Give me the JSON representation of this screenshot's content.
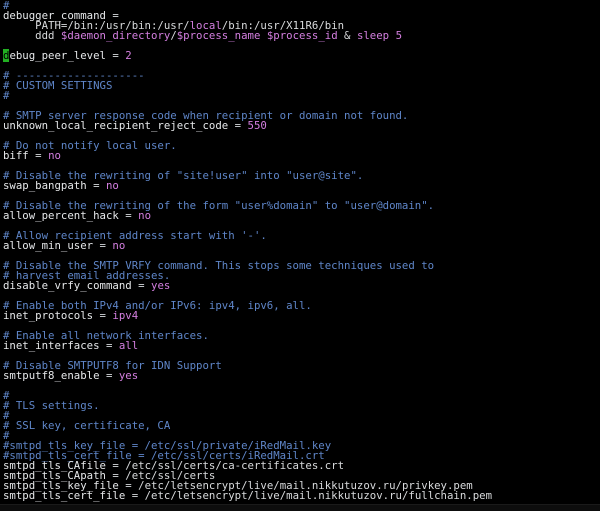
{
  "lines": [
    {
      "comment": "#"
    },
    {
      "key": "debugger_command",
      "eq": " ="
    },
    {
      "plain_a": "     PATH=/bin:/usr/bin:/usr/",
      "local": "local",
      "plain_b": "/bin:/usr/X11R6/bin"
    },
    {
      "plain_a": "     ddd ",
      "v1": "$daemon_directory",
      "plain_b": "/",
      "v2": "$process_name",
      "plain_c": " ",
      "v3": "$process_id",
      "plain_d": " & ",
      "v4": "sleep",
      "plain_e": " ",
      "v5": "5"
    },
    {
      "blank": true
    },
    {
      "cursor": "d",
      "key": "ebug_peer_level",
      "eq": " = ",
      "val": "2"
    },
    {
      "blank": true
    },
    {
      "comment": "# --------------------"
    },
    {
      "comment": "# CUSTOM SETTINGS"
    },
    {
      "comment": "#"
    },
    {
      "blank": true
    },
    {
      "comment": "# SMTP server response code when recipient or domain not found."
    },
    {
      "key": "unknown_local_recipient_reject_code",
      "eq": " = ",
      "val": "550"
    },
    {
      "blank": true
    },
    {
      "comment": "# Do not notify local user."
    },
    {
      "key": "biff",
      "eq": " = ",
      "val": "no"
    },
    {
      "blank": true
    },
    {
      "comment": "# Disable the rewriting of \"site!user\" into \"user@site\"."
    },
    {
      "key": "swap_bangpath",
      "eq": " = ",
      "val": "no"
    },
    {
      "blank": true
    },
    {
      "comment": "# Disable the rewriting of the form \"user%domain\" to \"user@domain\"."
    },
    {
      "key": "allow_percent_hack",
      "eq": " = ",
      "val": "no"
    },
    {
      "blank": true
    },
    {
      "comment": "# Allow recipient address start with '-'."
    },
    {
      "key": "allow_min_user",
      "eq": " = ",
      "val": "no"
    },
    {
      "blank": true
    },
    {
      "comment": "# Disable the SMTP VRFY command. This stops some techniques used to"
    },
    {
      "comment": "# harvest email addresses."
    },
    {
      "key": "disable_vrfy_command",
      "eq": " = ",
      "val": "yes"
    },
    {
      "blank": true
    },
    {
      "comment": "# Enable both IPv4 and/or IPv6: ipv4, ipv6, all."
    },
    {
      "key": "inet_protocols",
      "eq": " = ",
      "val": "ipv4"
    },
    {
      "blank": true
    },
    {
      "comment": "# Enable all network interfaces."
    },
    {
      "key": "inet_interfaces",
      "eq": " = ",
      "val": "all"
    },
    {
      "blank": true
    },
    {
      "comment": "# Disable SMTPUTF8 for IDN Support"
    },
    {
      "key": "smtputf8_enable",
      "eq": " = ",
      "val": "yes"
    },
    {
      "blank": true
    },
    {
      "comment": "#"
    },
    {
      "comment": "# TLS settings."
    },
    {
      "comment": "#"
    },
    {
      "comment": "# SSL key, certificate, CA"
    },
    {
      "comment": "#"
    },
    {
      "comment": "#smtpd_tls_key_file = /etc/ssl/private/iRedMail.key"
    },
    {
      "comment": "#smtpd_tls_cert_file = /etc/ssl/certs/iRedMail.crt"
    },
    {
      "key": "smtpd_tls_CAfile",
      "eq": " = ",
      "plain": "/etc/ssl/certs/ca-certificates.crt"
    },
    {
      "key": "smtpd_tls_CApath",
      "eq": " = ",
      "plain": "/etc/ssl/certs"
    },
    {
      "key": "smtpd_tls_key_file",
      "eq": " = ",
      "plain": "/etc/letsencrypt/live/mail.nikkutuzov.ru/privkey.pem"
    },
    {
      "key": "smtpd_tls_cert_file",
      "eq": " = ",
      "plain": "/etc/letsencrypt/live/mail.nikkutuzov.ru/fullchain.pem"
    }
  ],
  "colors": {
    "background": "#000000",
    "comment": "#5f86c9",
    "value": "#d47fe0",
    "key": "#e6e8ea",
    "cursor": "#22b022"
  }
}
